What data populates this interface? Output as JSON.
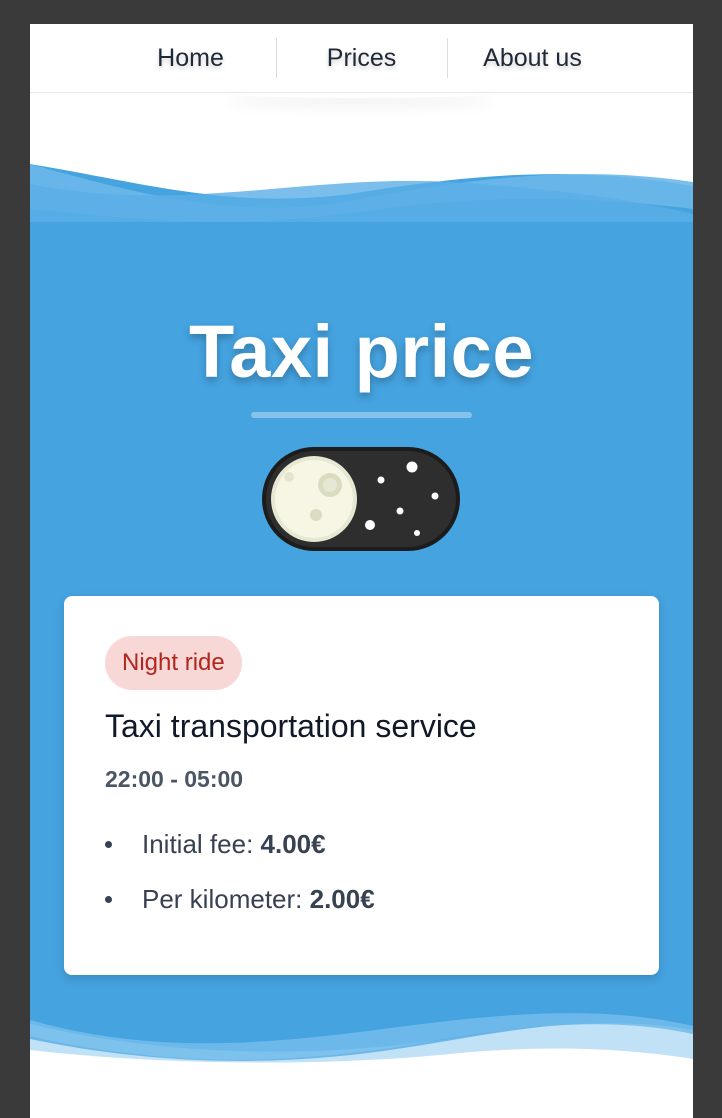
{
  "nav": {
    "items": [
      {
        "label": "Home"
      },
      {
        "label": "Prices"
      },
      {
        "label": "About us"
      }
    ]
  },
  "hero": {
    "title": "Taxi price",
    "theme_toggle": {
      "mode": "night",
      "icon": "moon-icon"
    }
  },
  "card": {
    "badge": "Night ride",
    "title": "Taxi transportation service",
    "hours": "22:00 - 05:00",
    "prices": [
      {
        "label": "Initial fee: ",
        "value": "4.00€"
      },
      {
        "label": "Per kilometer: ",
        "value": "2.00€"
      }
    ]
  },
  "colors": {
    "hero_blue": "#45a3e0",
    "wave_light": "#6cb8ea",
    "badge_bg": "#f8d7d7",
    "badge_text": "#b3261e"
  }
}
